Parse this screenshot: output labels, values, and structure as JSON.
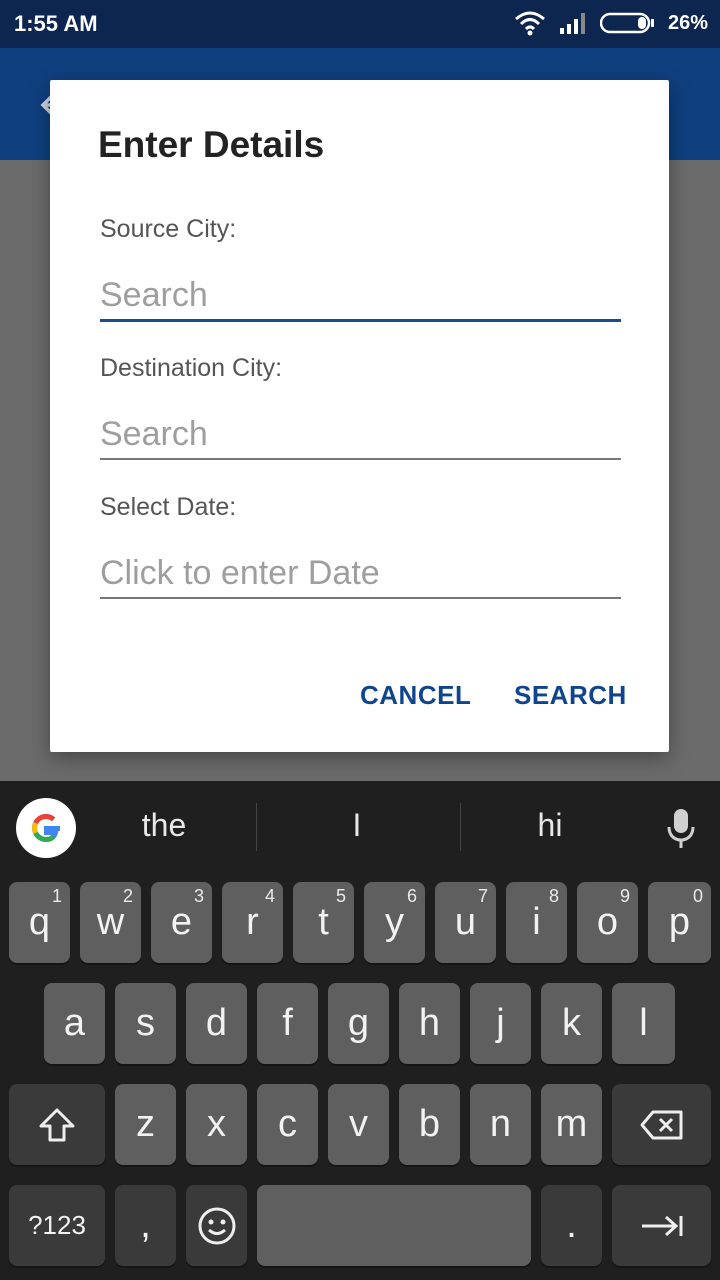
{
  "status": {
    "time": "1:55 AM",
    "battery": "26%"
  },
  "dialog": {
    "title": "Enter Details",
    "source_label": "Source City:",
    "source_placeholder": "Search",
    "destination_label": "Destination City:",
    "destination_placeholder": "Search",
    "date_label": "Select Date:",
    "date_placeholder": "Click to enter Date",
    "cancel": "CANCEL",
    "search": "SEARCH"
  },
  "keyboard": {
    "suggestions": [
      "the",
      "I",
      "hi"
    ],
    "row1": [
      {
        "k": "q",
        "n": "1"
      },
      {
        "k": "w",
        "n": "2"
      },
      {
        "k": "e",
        "n": "3"
      },
      {
        "k": "r",
        "n": "4"
      },
      {
        "k": "t",
        "n": "5"
      },
      {
        "k": "y",
        "n": "6"
      },
      {
        "k": "u",
        "n": "7"
      },
      {
        "k": "i",
        "n": "8"
      },
      {
        "k": "o",
        "n": "9"
      },
      {
        "k": "p",
        "n": "0"
      }
    ],
    "row2": [
      "a",
      "s",
      "d",
      "f",
      "g",
      "h",
      "j",
      "k",
      "l"
    ],
    "row3": [
      "z",
      "x",
      "c",
      "v",
      "b",
      "n",
      "m"
    ],
    "symbols": "?123",
    "comma": ",",
    "period": "."
  },
  "colors": {
    "primary": "#0f3f7e",
    "accent": "#1a4c94",
    "statusbar": "#0c264f"
  }
}
